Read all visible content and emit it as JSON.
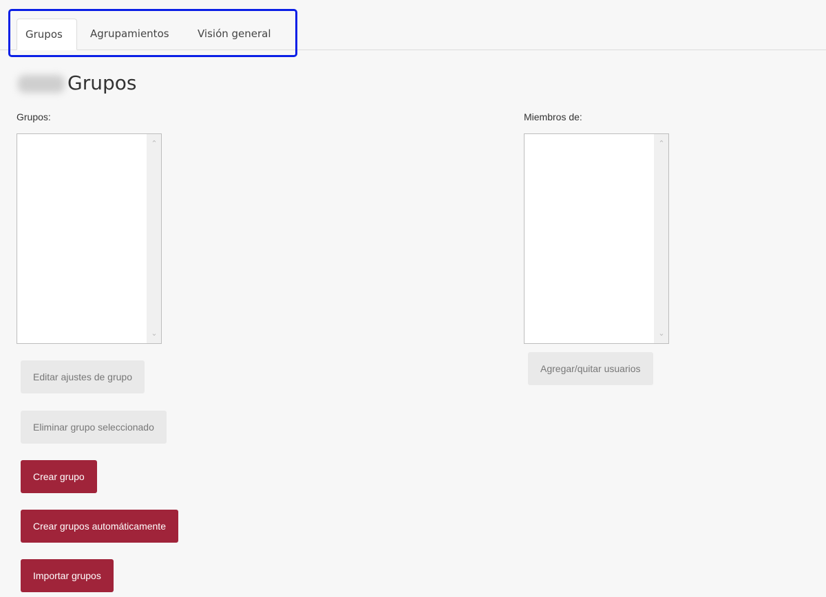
{
  "tabs": [
    {
      "label": "Grupos",
      "active": true
    },
    {
      "label": "Agrupamientos",
      "active": false
    },
    {
      "label": "Visión general",
      "active": false
    }
  ],
  "page": {
    "title": "Grupos"
  },
  "groups_panel": {
    "label": "Grupos:",
    "buttons": {
      "edit": "Editar ajustes de grupo",
      "delete": "Eliminar grupo seleccionado",
      "create": "Crear grupo",
      "auto_create": "Crear grupos automáticamente",
      "import": "Importar grupos"
    }
  },
  "members_panel": {
    "label": "Miembros de:",
    "buttons": {
      "add_remove": "Agregar/quitar usuarios"
    }
  },
  "colors": {
    "primary": "#a0243a",
    "highlight": "#0a1fe6",
    "disabled_bg": "#e9e9e9"
  }
}
